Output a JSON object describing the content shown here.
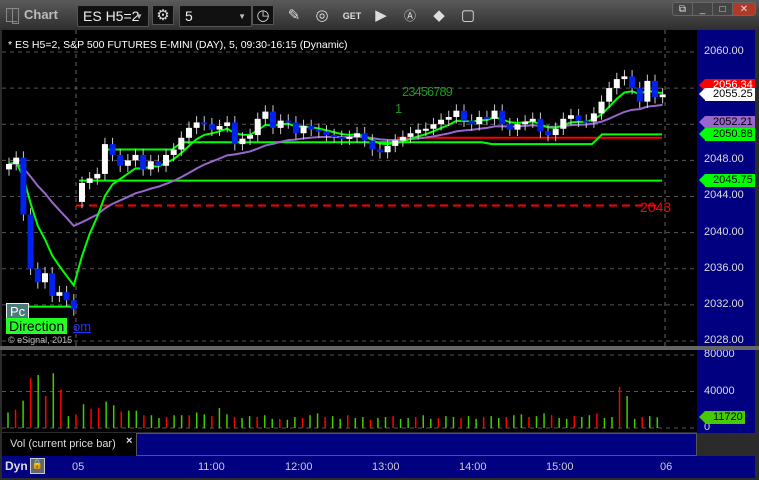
{
  "window": {
    "title": "Chart",
    "symbol": "ES H5=2",
    "interval": "5",
    "buttons": [
      "restore-menu",
      "minimize",
      "maximize",
      "close"
    ]
  },
  "header": "* ES H5=2, S&P 500 FUTURES E-MINI (DAY), 5, 09:30-16:15 (Dynamic)",
  "overlay": {
    "pc": "Pc",
    "direction": "Direction",
    "om": "om",
    "copyright": "© eSignal, 2015",
    "wave_1": "1",
    "wave_rest": "23456789",
    "level_2043": "2043"
  },
  "price_axis": {
    "labels": [
      "2060.00",
      "2056.00",
      "2052.00",
      "2048.00",
      "2044.00",
      "2040.00",
      "2036.00",
      "2032.00",
      "2028.00"
    ],
    "tags": [
      {
        "text": "2056.34",
        "color": "#ff0000",
        "fg": "#fff"
      },
      {
        "text": "2055.25",
        "color": "#ffffff",
        "fg": "#000"
      },
      {
        "text": "2052.21",
        "color": "#9966cc",
        "fg": "#000"
      },
      {
        "text": "2050.88",
        "color": "#00ff00",
        "fg": "#000"
      },
      {
        "text": "2045.75",
        "color": "#00ff00",
        "fg": "#000"
      }
    ]
  },
  "volume_axis": {
    "labels": [
      "80000",
      "40000",
      "0"
    ],
    "tag": "11720"
  },
  "volume_label": "Vol (current price bar)",
  "volume_close": "×",
  "bottom": {
    "dyn": "Dyn",
    "times": [
      "05",
      "11:00",
      "12:00",
      "13:00",
      "14:00",
      "15:00",
      "06"
    ]
  },
  "chart_data": {
    "type": "candlestick",
    "ylim": [
      2028,
      2060
    ],
    "day1_closes": [
      2047.6,
      2048.3,
      2042.0,
      2036.0,
      2034.5,
      2035.5,
      2033.0,
      2033.4,
      2032.5,
      2031.5
    ],
    "day2_open": 2043.4,
    "day2_closes": [
      2045.5,
      2046.0,
      2046.5,
      2049.8,
      2048.6,
      2047.4,
      2048.0,
      2048.6,
      2047.0,
      2047.9,
      2047.4,
      2048.6,
      2049.2,
      2050.5,
      2051.6,
      2052.2,
      2052.0,
      2051.4,
      2051.8,
      2052.2,
      2049.8,
      2050.4,
      2050.8,
      2052.6,
      2053.4,
      2051.6,
      2052.4,
      2052.2,
      2051.0,
      2051.8,
      2051.4,
      2051.2,
      2050.8,
      2050.6,
      2050.4,
      2050.6,
      2051.0,
      2050.2,
      2049.2,
      2048.9,
      2049.6,
      2050.2,
      2050.6,
      2051.0,
      2051.4,
      2051.5,
      2052.0,
      2052.5,
      2052.8,
      2053.5,
      2052.4,
      2052.0,
      2052.8,
      2052.6,
      2053.5,
      2052.0,
      2051.4,
      2052.0,
      2052.3,
      2052.6,
      2051.2,
      2050.8,
      2051.5,
      2052.6,
      2053.0,
      2052.4,
      2052.3,
      2053.2,
      2054.5,
      2056.0,
      2057.0,
      2057.3,
      2056.0,
      2054.5,
      2056.8,
      2055.0,
      2055.3
    ],
    "levels": {
      "dashed_red": 2043,
      "green_low": 2045.75,
      "red_mid": 2050.5,
      "green_step_1": 2049.2,
      "green_step_2": 2050.0,
      "green_step_3": 2050.88
    },
    "volume_ylim": [
      0,
      80000
    ],
    "volume": [
      17000,
      20000,
      30000,
      55000,
      58000,
      35000,
      60000,
      42000,
      13000,
      15000,
      26000,
      21000,
      22000,
      29000,
      25000,
      18000,
      19000,
      19000,
      14000,
      14000,
      11000,
      12000,
      14000,
      14000,
      14000,
      17000,
      15000,
      13000,
      22000,
      15000,
      12000,
      11000,
      13000,
      12000,
      14000,
      10000,
      10000,
      9000,
      12000,
      11000,
      14000,
      16000,
      12000,
      13000,
      10000,
      14000,
      11000,
      12000,
      9000,
      11000,
      12000,
      13000,
      10000,
      11000,
      12000,
      14000,
      10000,
      11000,
      13000,
      12000,
      11000,
      13000,
      10000,
      12000,
      13000,
      11000,
      12000,
      14000,
      15000,
      12000,
      13000,
      16000,
      14000,
      11000,
      10000,
      13000,
      12000,
      14000,
      16000,
      11000,
      12000,
      45000,
      35000,
      10000,
      12000,
      13000,
      11720
    ]
  }
}
